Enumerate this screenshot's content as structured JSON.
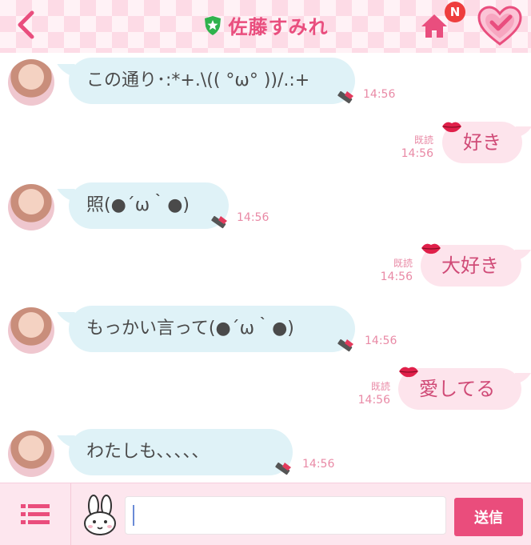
{
  "header": {
    "title": "佐藤すみれ",
    "notification_badge": "N",
    "accent_color": "#e94e7e"
  },
  "messages": [
    {
      "direction": "in",
      "text": "この通り･:*+.\\(( °ω° ))/.:+",
      "time": "14:56"
    },
    {
      "direction": "out",
      "text": "好き",
      "read": "既読",
      "time": "14:56"
    },
    {
      "direction": "in",
      "text": "照(●´ω｀●)",
      "time": "14:56"
    },
    {
      "direction": "out",
      "text": "大好き",
      "read": "既読",
      "time": "14:56"
    },
    {
      "direction": "in",
      "text": "もっかい言って(●´ω｀●)",
      "time": "14:56"
    },
    {
      "direction": "out",
      "text": "愛してる",
      "read": "既読",
      "time": "14:56"
    },
    {
      "direction": "in",
      "text": "わたしも、、、、、",
      "time": "14:56"
    }
  ],
  "input": {
    "value": "",
    "send_label": "送信"
  },
  "icons": [
    "back-arrow-icon",
    "shield-star-icon",
    "home-icon",
    "heart-check-icon",
    "lips-icon",
    "lipstick-icon",
    "menu-list-icon",
    "rabbit-sticker-icon"
  ]
}
